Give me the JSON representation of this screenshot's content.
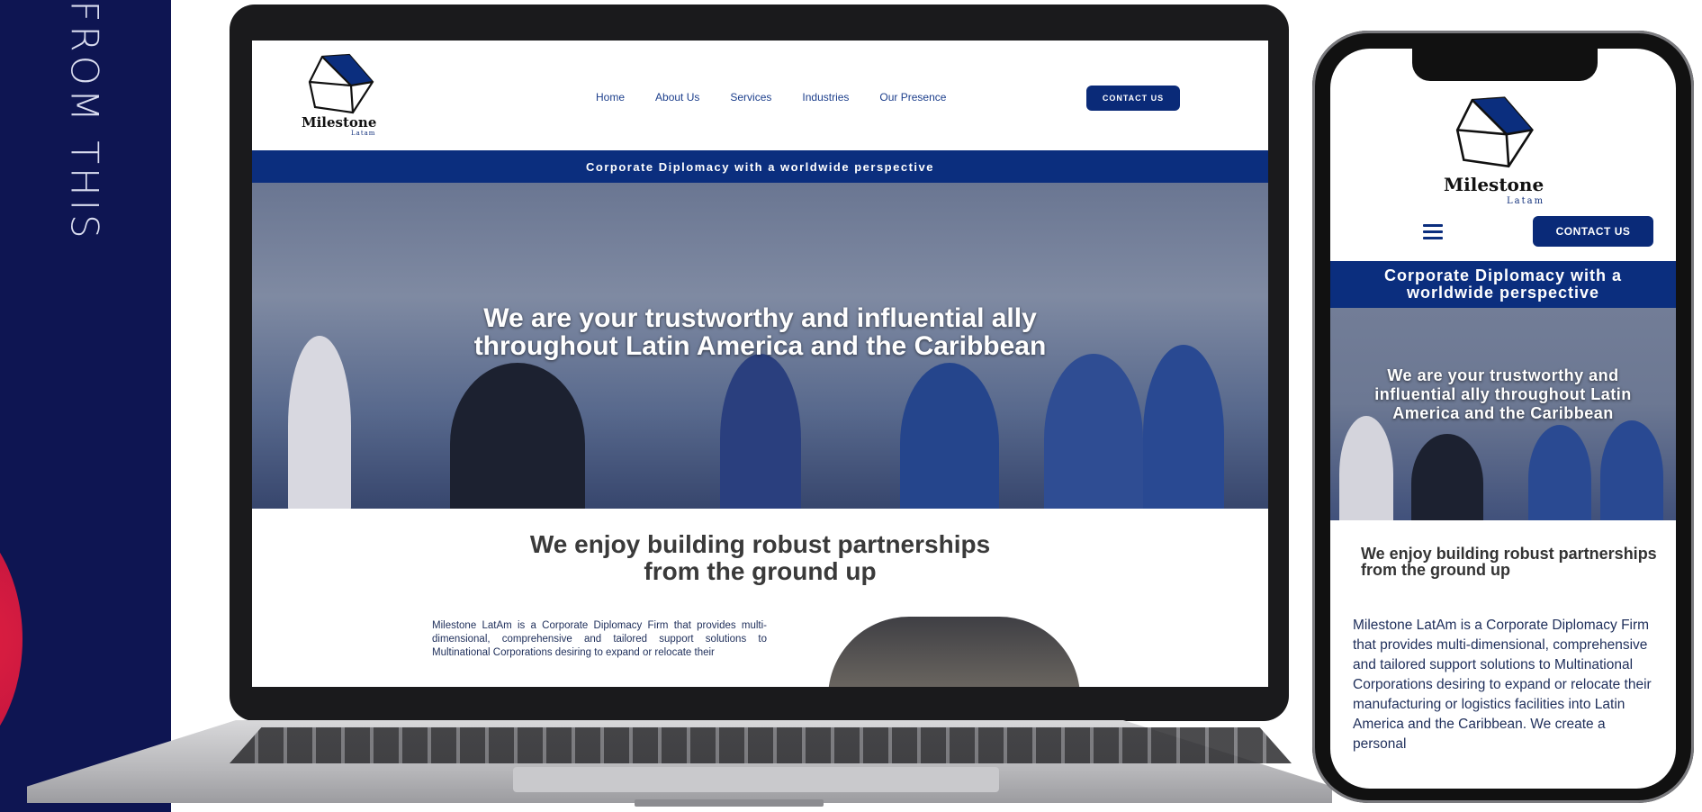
{
  "side_text": "FROM THIS",
  "desktop": {
    "logo": {
      "name": "Milestone",
      "sub": "Latam"
    },
    "nav": [
      "Home",
      "About Us",
      "Services",
      "Industries",
      "Our Presence"
    ],
    "contact_label": "CONTACT US",
    "tagline": "Corporate Diplomacy with a worldwide perspective",
    "hero_line1": "We are your trustworthy and influential ally",
    "hero_line2": "throughout Latin America and the Caribbean",
    "section_line1": "We enjoy building robust partnerships",
    "section_line2": "from the ground up",
    "paragraph": "Milestone LatAm is a Corporate Diplomacy Firm that provides multi-dimensional, comprehensive and tailored support solutions to Multinational Corporations desiring to expand or relocate their"
  },
  "mobile": {
    "logo": {
      "name": "Milestone",
      "sub": "Latam"
    },
    "contact_label": "CONTACT US",
    "tagline": "Corporate Diplomacy with a worldwide perspective",
    "hero_text": "We are your trustworthy and influential ally throughout Latin America and the Caribbean",
    "section_title": "We enjoy building robust partnerships from the ground up",
    "paragraph": "Milestone LatAm is a Corporate Diplomacy Firm that provides multi-dimensional, comprehensive and tailored support solutions to Multinational Corporations desiring to expand or relocate their manufacturing or logistics facilities into Latin America and the Caribbean. We create a personal"
  },
  "colors": {
    "navy": "#0b2e7e",
    "panel": "#0e1552",
    "accent_red": "#c4153f"
  },
  "icons": [
    "milestone-logo-icon",
    "hamburger-menu-icon"
  ]
}
